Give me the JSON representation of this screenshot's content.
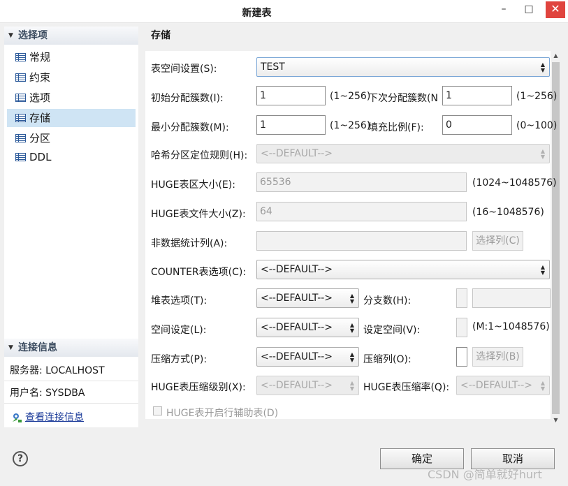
{
  "window": {
    "title": "新建表",
    "min": "–",
    "max": "□",
    "close": "✕"
  },
  "sidebar": {
    "options_header": "选择项",
    "items": [
      {
        "label": "常规"
      },
      {
        "label": "约束"
      },
      {
        "label": "选项"
      },
      {
        "label": "存储",
        "selected": true
      },
      {
        "label": "分区"
      },
      {
        "label": "DDL"
      }
    ],
    "conn_header": "连接信息",
    "server": "服务器: LOCALHOST",
    "user": "用户名: SYSDBA",
    "view_link": "查看连接信息"
  },
  "main": {
    "section_title": "存储",
    "tablespace": {
      "label": "表空间设置(S):",
      "value": "TEST"
    },
    "init_extents": {
      "label": "初始分配簇数(I):",
      "value": "1",
      "range": "(1~256)"
    },
    "next_extents": {
      "label": "下次分配簇数(N",
      "value": "1",
      "range": "(1~256)"
    },
    "min_extents": {
      "label": "最小分配簇数(M):",
      "value": "1",
      "range": "(1~256)"
    },
    "fill_factor": {
      "label": "填充比例(F):",
      "value": "0",
      "range": "(0~100)"
    },
    "hash_rule": {
      "label": "哈希分区定位规则(H):",
      "value": "<--DEFAULT-->"
    },
    "huge_extent": {
      "label": "HUGE表区大小(E):",
      "value": "65536",
      "range": "(1024~1048576)"
    },
    "huge_file": {
      "label": "HUGE表文件大小(Z):",
      "value": "64",
      "range": "(16~1048576)"
    },
    "non_stat": {
      "label": "非数据统计列(A):",
      "value": "",
      "button": "选择列(C)"
    },
    "counter": {
      "label": "COUNTER表选项(C):",
      "value": "<--DEFAULT-->"
    },
    "heap": {
      "label": "堆表选项(T):",
      "value": "<--DEFAULT-->"
    },
    "branch": {
      "label": "分支数(H):"
    },
    "space": {
      "label": "空间设定(L):",
      "value": "<--DEFAULT-->"
    },
    "set_space": {
      "label": "设定空间(V):",
      "range": "(M:1~1048576)"
    },
    "compress": {
      "label": "压缩方式(P):",
      "value": "<--DEFAULT-->"
    },
    "compress_cols": {
      "label": "压缩列(O):",
      "button": "选择列(B)"
    },
    "huge_level": {
      "label": "HUGE表压缩级别(X):",
      "value": "<--DEFAULT-->"
    },
    "huge_rate": {
      "label": "HUGE表压缩率(Q):",
      "value": "<--DEFAULT-->"
    },
    "huge_aux": {
      "label": "HUGE表开启行辅助表(D)"
    }
  },
  "footer": {
    "help": "?",
    "ok": "确定",
    "cancel": "取消",
    "watermark": "CSDN @简单就好hurt"
  }
}
